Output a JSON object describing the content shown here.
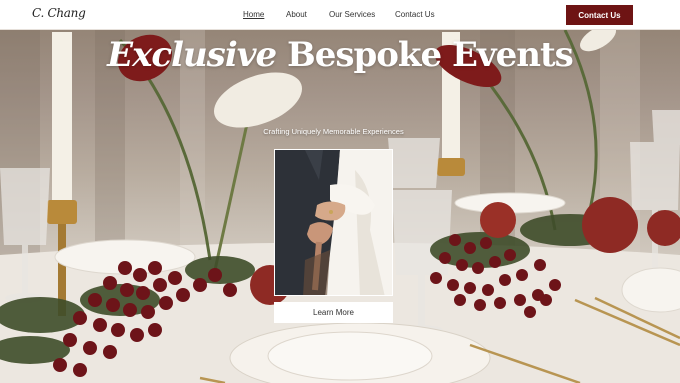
{
  "brand": {
    "logo_text": "C. Chang"
  },
  "nav": {
    "links": [
      {
        "label": "Home",
        "active": true
      },
      {
        "label": "About",
        "active": false
      },
      {
        "label": "Our Services",
        "active": false
      },
      {
        "label": "Contact Us",
        "active": false
      }
    ],
    "cta_label": "Contact Us"
  },
  "hero": {
    "title_emphasis": "Exclusive",
    "title_rest": "Bespoke Events",
    "subtitle": "Crafting Uniquely Memorable Experiences",
    "button_label": "Learn More",
    "image_subject": "couple-holding-hands"
  },
  "background": {
    "subject": "dinner-table-with-grapes-candles-flowers"
  },
  "colors": {
    "accent": "#6e1414",
    "nav_bg": "#ffffff",
    "hero_text": "#ffffff"
  }
}
